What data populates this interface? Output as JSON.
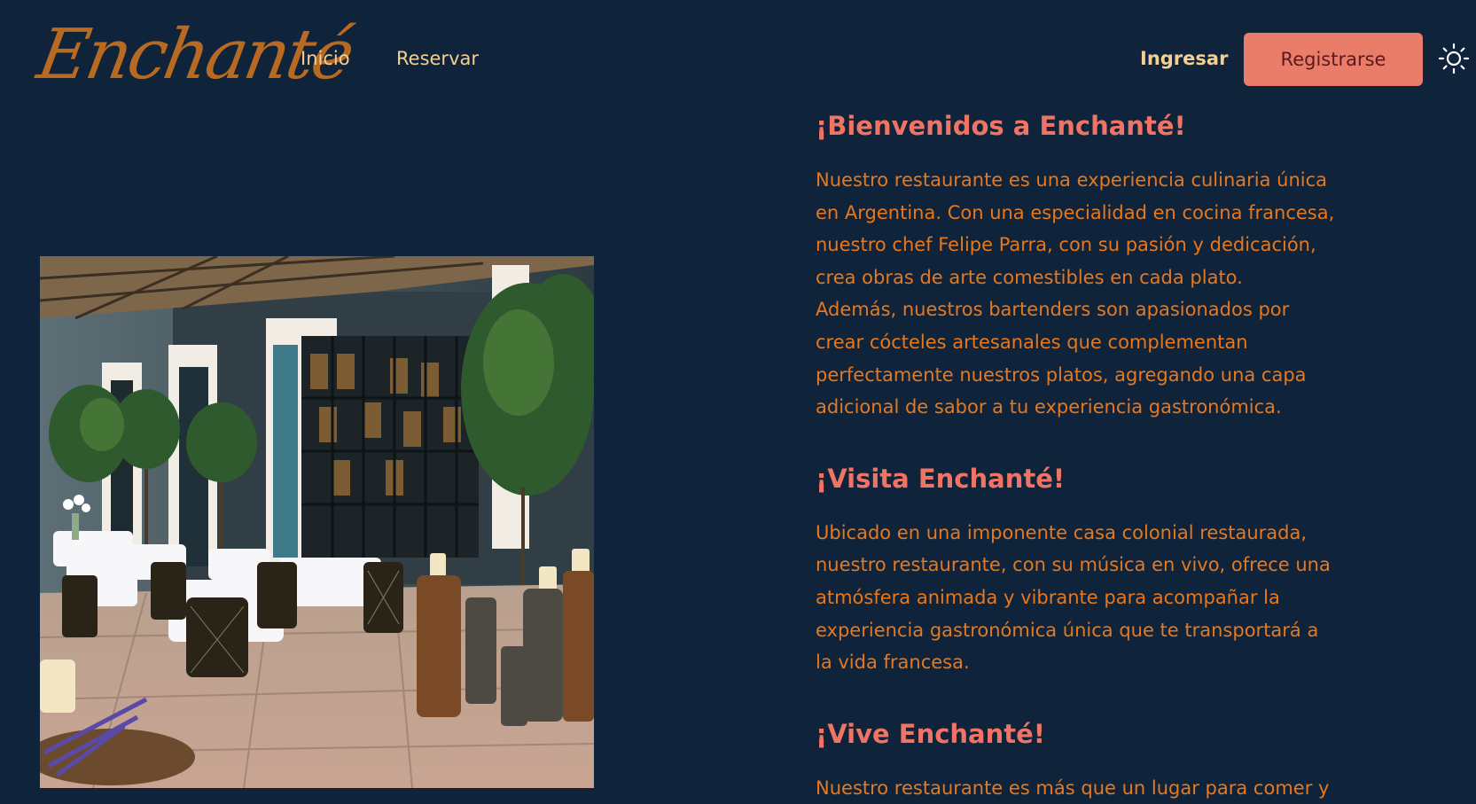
{
  "nav": {
    "logo_text": "Enchanté",
    "links": [
      "Inicio",
      "Reservar"
    ],
    "login_label": "Ingresar",
    "register_label": "Registrarse",
    "theme_icon": "sun-icon"
  },
  "colors": {
    "background": "#0f233a",
    "logo": "#b86a22",
    "nav_text": "#f2cf95",
    "accent_button": "#e97d69",
    "heading": "#ef7466",
    "body_text": "#e6781e"
  },
  "image": {
    "description_icon": "restaurant-patio-photo"
  },
  "sections": [
    {
      "heading": "¡Bienvenidos a Enchanté!",
      "lines": [
        "Nuestro restaurante es una experiencia culinaria única",
        "en Argentina. Con una especialidad en cocina francesa,",
        "nuestro chef Felipe Parra, con su pasión y dedicación,",
        "crea obras de arte comestibles en cada plato.",
        "Además, nuestros bartenders son apasionados por",
        "crear cócteles artesanales que complementan",
        "perfectamente nuestros platos, agregando una capa",
        "adicional de sabor a tu experiencia gastronómica."
      ]
    },
    {
      "heading": "¡Visita Enchanté!",
      "lines": [
        "Ubicado en una imponente casa colonial restaurada,",
        "nuestro restaurante, con su música en vivo, ofrece una",
        "atmósfera animada y vibrante para acompañar la",
        "experiencia gastronómica única que te transportará a",
        "la vida francesa."
      ]
    },
    {
      "heading": "¡Vive Enchanté!",
      "lines": [
        "Nuestro restaurante es más que un lugar para comer y"
      ]
    }
  ]
}
